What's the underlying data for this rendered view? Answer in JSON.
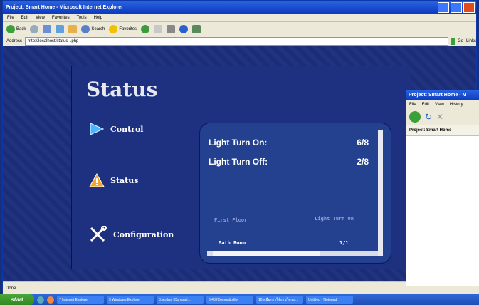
{
  "ie": {
    "title": "Project: Smart Home - Microsoft Internet Explorer",
    "menu": [
      "File",
      "Edit",
      "View",
      "Favorites",
      "Tools",
      "Help"
    ],
    "toolbar": {
      "back": "Back",
      "search": "Search",
      "favorites": "Favorites"
    },
    "address_label": "Address",
    "address_value": "http://localhost/status_.php",
    "go_label": "Go",
    "links_label": "Links",
    "status_text": "Done"
  },
  "page": {
    "heading": "Status",
    "nav": [
      {
        "label": "Control",
        "icon": "play-triangle-icon"
      },
      {
        "label": "Status",
        "icon": "warning-icon"
      },
      {
        "label": "Configuration",
        "icon": "tools-icon"
      }
    ],
    "summary": [
      {
        "label": "Light Turn On:",
        "value": "6/8"
      },
      {
        "label": "Light Turn Off:",
        "value": "2/8"
      }
    ],
    "table": {
      "headers": [
        "First Floor",
        "Light Turn On"
      ],
      "rows": [
        {
          "room": "Bath Room",
          "value": "1/1"
        }
      ]
    }
  },
  "firefox": {
    "title": "Project: Smart Home - M",
    "menu": [
      "File",
      "Edit",
      "View",
      "History"
    ],
    "tab": "Project: Smart Home"
  },
  "taskbar": {
    "start": "start",
    "tasks": [
      "7 Internet Explorer",
      "3 Windows Explorer",
      "3.สรุปผล [Compati...",
      "6.43 [Compatibility",
      "10.คู่มือการใช้งานโครง...",
      "Untitled - Notepad"
    ]
  },
  "colors": {
    "page_bg": "#1d2e7b",
    "panel_bg": "#23418f",
    "accent_title": "#0d3bbf"
  }
}
